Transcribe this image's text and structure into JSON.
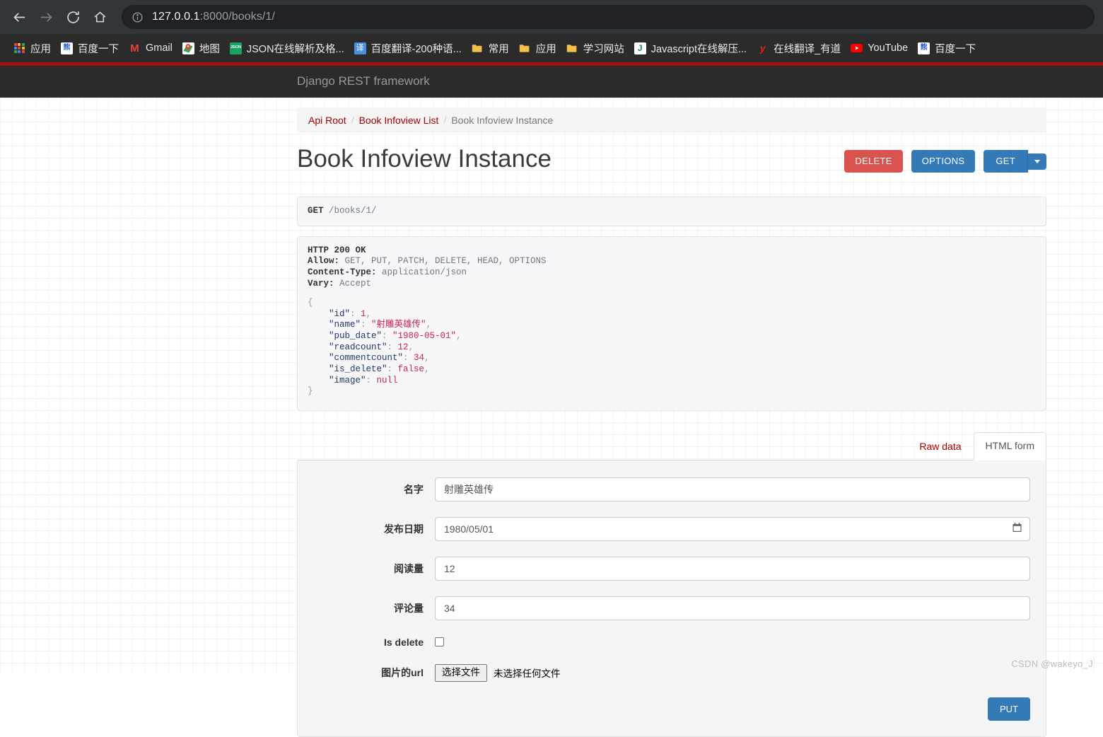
{
  "browser": {
    "nav": {
      "back": "back-arrow",
      "forward": "forward-arrow",
      "reload": "reload",
      "home": "home"
    },
    "omnibox": {
      "security_icon": "info-circle-icon",
      "host": "127.0.0.1",
      "path": ":8000/books/1/",
      "full_url": "127.0.0.1:8000/books/1/"
    },
    "bookmarks": [
      {
        "label": "应用",
        "icon": "apps-grid-icon"
      },
      {
        "label": "百度一下",
        "icon": "baidu-icon"
      },
      {
        "label": "Gmail",
        "icon": "gmail-icon"
      },
      {
        "label": "地图",
        "icon": "google-maps-icon"
      },
      {
        "label": "JSON在线解析及格...",
        "icon": "json-icon"
      },
      {
        "label": "百度翻译-200种语...",
        "icon": "translate-icon"
      },
      {
        "label": "常用",
        "icon": "folder-icon"
      },
      {
        "label": "应用",
        "icon": "folder-icon"
      },
      {
        "label": "学习网站",
        "icon": "folder-icon"
      },
      {
        "label": "Javascript在线解压...",
        "icon": "javascript-icon"
      },
      {
        "label": "在线翻译_有道",
        "icon": "youdao-icon"
      },
      {
        "label": "YouTube",
        "icon": "youtube-icon"
      },
      {
        "label": "百度一下",
        "icon": "baidu-icon"
      }
    ]
  },
  "navbar": {
    "brand": "Django REST framework"
  },
  "breadcrumb": {
    "items": [
      {
        "label": "Api Root",
        "active": false
      },
      {
        "label": "Book Infoview List",
        "active": false
      },
      {
        "label": "Book Infoview Instance",
        "active": true
      }
    ],
    "separator": "/"
  },
  "page": {
    "title": "Book Infoview Instance",
    "actions": {
      "delete": "DELETE",
      "options": "OPTIONS",
      "get": "GET",
      "caret": "chevron-down-icon"
    }
  },
  "request": {
    "method": "GET",
    "path": "/books/1/"
  },
  "response": {
    "status_line": "HTTP 200 OK",
    "headers": [
      {
        "name": "Allow:",
        "value": "GET, PUT, PATCH, DELETE, HEAD, OPTIONS"
      },
      {
        "name": "Content-Type:",
        "value": "application/json"
      },
      {
        "name": "Vary:",
        "value": "Accept"
      }
    ],
    "body": {
      "open_brace": "{",
      "close_brace": "}",
      "fields": [
        {
          "key": "\"id\"",
          "colon": ": ",
          "value": "1",
          "type": "num",
          "comma": ","
        },
        {
          "key": "\"name\"",
          "colon": ": ",
          "value": "\"射雕英雄传\"",
          "type": "str",
          "comma": ","
        },
        {
          "key": "\"pub_date\"",
          "colon": ": ",
          "value": "\"1980-05-01\"",
          "type": "str",
          "comma": ","
        },
        {
          "key": "\"readcount\"",
          "colon": ": ",
          "value": "12",
          "type": "num",
          "comma": ","
        },
        {
          "key": "\"commentcount\"",
          "colon": ": ",
          "value": "34",
          "type": "num",
          "comma": ","
        },
        {
          "key": "\"is_delete\"",
          "colon": ": ",
          "value": "false",
          "type": "lit",
          "comma": ","
        },
        {
          "key": "\"image\"",
          "colon": ": ",
          "value": "null",
          "type": "lit",
          "comma": ""
        }
      ]
    }
  },
  "tabs": [
    {
      "label": "Raw data",
      "active": false
    },
    {
      "label": "HTML form",
      "active": true
    }
  ],
  "form": {
    "fields": [
      {
        "label": "名字",
        "type": "text",
        "value": "射雕英雄传"
      },
      {
        "label": "发布日期",
        "type": "date",
        "value": "1980/05/01",
        "icon": "calendar-icon"
      },
      {
        "label": "阅读量",
        "type": "number",
        "value": "12"
      },
      {
        "label": "评论量",
        "type": "number",
        "value": "34"
      },
      {
        "label": "Is delete",
        "type": "checkbox",
        "checked": false
      },
      {
        "label": "图片的url",
        "type": "file",
        "button": "选择文件",
        "filename": "未选择任何文件"
      }
    ],
    "submit": "PUT"
  },
  "watermark": "CSDN @wakeyo_J",
  "colors": {
    "chrome_bg": "#323639",
    "bookmarks_bg": "#2b2b2b",
    "red_divider": "#a50f0f",
    "navbar_bg": "#2b2b2b",
    "danger": "#d9534f",
    "primary": "#337ab7",
    "link": "#a30000"
  }
}
